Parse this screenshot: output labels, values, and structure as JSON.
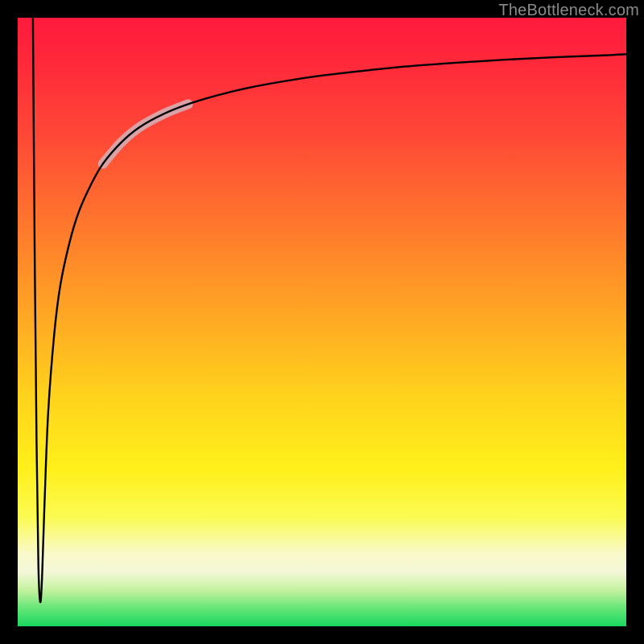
{
  "attribution": "TheBottleneck.com",
  "chart_data": {
    "type": "line",
    "title": "",
    "xlabel": "",
    "ylabel": "",
    "xlim": [
      0,
      100
    ],
    "ylim": [
      0,
      100
    ],
    "grid": false,
    "legend": false,
    "series": [
      {
        "name": "curve",
        "x": [
          2.5,
          2.8,
          3.1,
          3.4,
          3.7,
          4.0,
          4.4,
          5.0,
          6.0,
          7.0,
          8.5,
          10,
          12,
          14,
          17,
          20,
          24,
          28,
          33,
          38,
          44,
          50,
          57,
          64,
          72,
          80,
          88,
          96,
          100
        ],
        "y": [
          100,
          60,
          30,
          10,
          4,
          8,
          20,
          35,
          48,
          56,
          63,
          68,
          72.5,
          76,
          79.5,
          82,
          84.2,
          85.8,
          87.3,
          88.5,
          89.6,
          90.5,
          91.3,
          92.0,
          92.6,
          93.1,
          93.5,
          93.8,
          94.0
        ]
      }
    ],
    "highlight_segment": {
      "x_start": 17,
      "x_end": 26
    },
    "gradient_stops": [
      {
        "pos": 0.0,
        "color": "#ff1a3c"
      },
      {
        "pos": 0.35,
        "color": "#ff7a2c"
      },
      {
        "pos": 0.62,
        "color": "#ffd21c"
      },
      {
        "pos": 0.88,
        "color": "#f9f9c9"
      },
      {
        "pos": 1.0,
        "color": "#18d65f"
      }
    ]
  }
}
